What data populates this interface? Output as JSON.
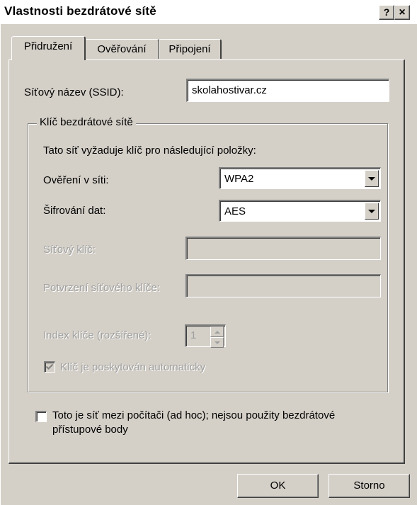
{
  "window": {
    "title": "Vlastnosti bezdrátové sítě",
    "help_label": "?",
    "close_label": "×"
  },
  "tabs": [
    {
      "label": "Přidružení",
      "active": true
    },
    {
      "label": "Ověřování",
      "active": false
    },
    {
      "label": "Připojení",
      "active": false
    }
  ],
  "ssid": {
    "label": "Síťový název (SSID):",
    "value": "skolahostivar.cz"
  },
  "key_group": {
    "title": "Klíč bezdrátové sítě",
    "info": "Tato síť vyžaduje klíč pro následující položky:",
    "auth_label": "Ověření v síti:",
    "auth_value": "WPA2",
    "enc_label": "Šifrování dat:",
    "enc_value": "AES",
    "netkey_label": "Síťový klíč:",
    "netkey_value": "",
    "confirm_label": "Potvrzení síťového klíče:",
    "confirm_value": "",
    "index_label": "Index klíče (rozšířené):",
    "index_value": "1",
    "auto_key_label": "Klíč je poskytován automaticky",
    "auto_key_checked": true
  },
  "adhoc": {
    "label_line1": "Toto je síť mezi počítači (ad hoc); nejsou použity bezdrátové",
    "label_line2": "přístupové body",
    "checked": false
  },
  "buttons": {
    "ok": "OK",
    "cancel": "Storno"
  },
  "colors": {
    "face": "#d4d0c8",
    "shadow": "#808080",
    "disabled_text": "#a0a0a0"
  }
}
